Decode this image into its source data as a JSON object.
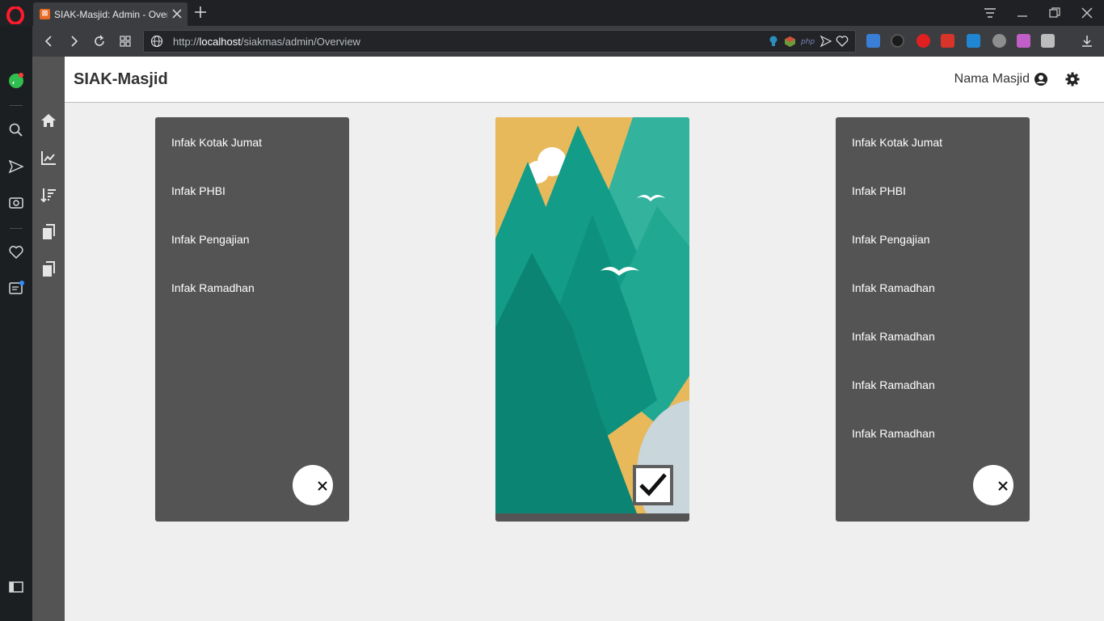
{
  "browser": {
    "tab_title": "SIAK-Masjid: Admin - Overview",
    "tab_favicon_letter": "⊠",
    "url_prefix": "http://",
    "url_host": "localhost",
    "url_path": "/siakmas/admin/Overview"
  },
  "header": {
    "brand": "SIAK-Masjid",
    "user_name": "Nama Masjid"
  },
  "left_card": {
    "items": [
      "Infak Kotak Jumat",
      "Infak PHBI",
      "Infak Pengajian",
      "Infak Ramadhan"
    ]
  },
  "right_card": {
    "items": [
      "Infak Kotak Jumat",
      "Infak PHBI",
      "Infak Pengajian",
      "Infak Ramadhan",
      "Infak Ramadhan",
      "Infak Ramadhan",
      "Infak Ramadhan"
    ]
  },
  "icons": {
    "opera": "opera-logo-icon",
    "sidebar": [
      "home-icon",
      "chart-line-icon",
      "sort-amount-icon",
      "copy-icon",
      "copy-icon"
    ],
    "header": [
      "user-circle-icon",
      "gear-icon"
    ]
  },
  "colors": {
    "sidebar_bg": "#545454",
    "card_bg": "#545454",
    "page_bg": "#efefef",
    "sky": "#e7b95b",
    "tree_light": "#33b29d",
    "tree_mid": "#139c88",
    "tree_dark": "#0b8474"
  }
}
